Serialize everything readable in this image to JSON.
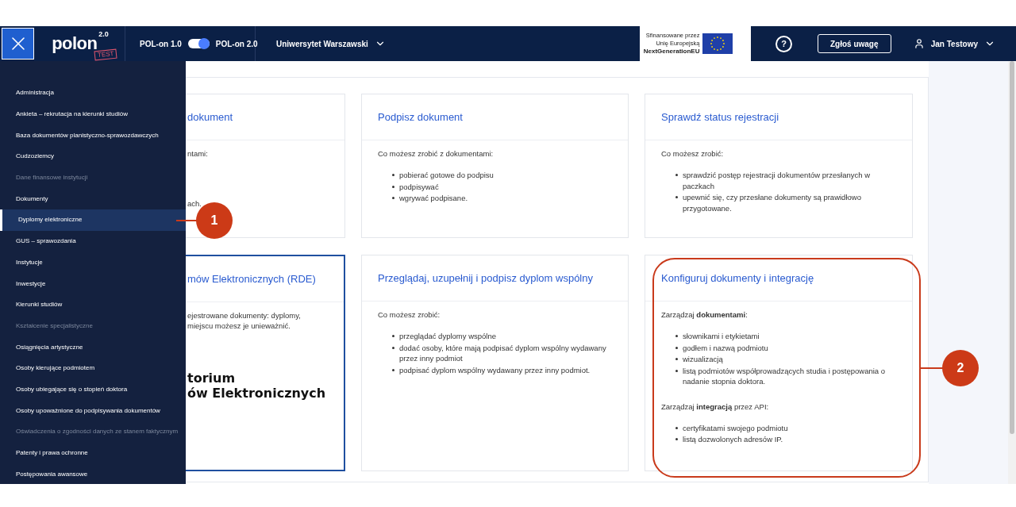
{
  "header": {
    "logo": {
      "name": "polon",
      "version": "2.0",
      "stamp": "TEST"
    },
    "version_switch": {
      "left": "POL-on 1.0",
      "right": "POL-on 2.0",
      "on": true
    },
    "institution": "Uniwersytet Warszawski",
    "eu_badge": {
      "lines": [
        "Sfinansowane przez",
        "Unię Europejską",
        "NextGenerationEU"
      ]
    },
    "help": "?",
    "feedback_button": "Zgłoś uwagę",
    "user": "Jan Testowy"
  },
  "sidebar": {
    "items": [
      {
        "label": "Administracja",
        "selected": false,
        "disabled": false
      },
      {
        "label": "Ankieta – rekrutacja na kierunki studiów",
        "selected": false,
        "disabled": false
      },
      {
        "label": "Baza dokumentów planistyczno-sprawozdawczych",
        "selected": false,
        "disabled": false
      },
      {
        "label": "Cudzoziemcy",
        "selected": false,
        "disabled": false
      },
      {
        "label": "Dane finansowe instytucji",
        "selected": false,
        "disabled": true
      },
      {
        "label": "Dokumenty",
        "selected": false,
        "disabled": false
      },
      {
        "label": "Dyplomy elektroniczne",
        "selected": true,
        "disabled": false
      },
      {
        "label": "GUS – sprawozdania",
        "selected": false,
        "disabled": false
      },
      {
        "label": "Instytucje",
        "selected": false,
        "disabled": false
      },
      {
        "label": "Inwestycje",
        "selected": false,
        "disabled": false
      },
      {
        "label": "Kierunki studiów",
        "selected": false,
        "disabled": false
      },
      {
        "label": "Kształcenie specjalistyczne",
        "selected": false,
        "disabled": true
      },
      {
        "label": "Osiągnięcia artystyczne",
        "selected": false,
        "disabled": false
      },
      {
        "label": "Osoby kierujące podmiotem",
        "selected": false,
        "disabled": false
      },
      {
        "label": "Osoby ubiegające się o stopień doktora",
        "selected": false,
        "disabled": false
      },
      {
        "label": "Osoby upoważnione do podpisywania dokumentów",
        "selected": false,
        "disabled": false
      },
      {
        "label": "Oświadczenia o zgodności danych ze stanem faktycznym",
        "selected": false,
        "disabled": true
      },
      {
        "label": "Patenty i prawa ochronne",
        "selected": false,
        "disabled": false
      },
      {
        "label": "Postępowania awansowe",
        "selected": false,
        "disabled": false
      }
    ]
  },
  "cards": [
    {
      "kind": "partial",
      "highlighted": false,
      "title": "dokument",
      "body": [
        {
          "kind": "text",
          "text": "ntami:"
        },
        {
          "kind": "gap"
        },
        {
          "kind": "text",
          "text": "ach."
        }
      ]
    },
    {
      "kind": "full",
      "highlighted": false,
      "title": "Podpisz dokument",
      "body": [
        {
          "kind": "text",
          "text": "Co możesz zrobić z dokumentami:"
        },
        {
          "kind": "list",
          "items": [
            "pobierać gotowe do podpisu",
            "podpisywać",
            "wgrywać podpisane."
          ]
        }
      ]
    },
    {
      "kind": "full",
      "highlighted": false,
      "title": "Sprawdź status rejestracji",
      "body": [
        {
          "kind": "text",
          "text": "Co możesz zrobić:"
        },
        {
          "kind": "list",
          "items": [
            "sprawdzić postęp rejestracji dokumentów przesłanych w paczkach",
            "upewnić się, czy przesłane dokumenty są prawidłowo przygotowane."
          ]
        }
      ]
    },
    {
      "kind": "partial",
      "highlighted": true,
      "title": "mów Elektronicznych (RDE)",
      "body": [
        {
          "kind": "text",
          "text": "ejestrowane dokumenty: dyplomy,"
        },
        {
          "kind": "text",
          "text": "miejscu możesz je unieważnić."
        },
        {
          "kind": "logo",
          "lines": [
            "torium",
            "ów Elektronicznych"
          ]
        }
      ]
    },
    {
      "kind": "full",
      "highlighted": false,
      "title": "Przeglądaj, uzupełnij i podpisz dyplom wspólny",
      "body": [
        {
          "kind": "text",
          "text": "Co możesz zrobić:"
        },
        {
          "kind": "list",
          "items": [
            "przeglądać dyplomy wspólne",
            "dodać osoby, które mają podpisać dyplom wspólny wydawany przez inny podmiot",
            "podpisać dyplom wspólny wydawany przez inny podmiot."
          ]
        }
      ]
    },
    {
      "kind": "full",
      "highlighted": false,
      "title": "Konfiguruj dokumenty i integrację",
      "body": [
        {
          "kind": "text",
          "text": "Zarządzaj **dokumentami**:"
        },
        {
          "kind": "list",
          "items": [
            "słownikami i etykietami",
            "godłem i nazwą podmiotu",
            "wizualizacją",
            "listą podmiotów współprowadzących studia i postępowania o nadanie stopnia doktora."
          ]
        },
        {
          "kind": "text",
          "text": "Zarządzaj **integracją** przez API:"
        },
        {
          "kind": "list",
          "items": [
            "certyfikatami swojego podmiotu",
            "listą dozwolonych adresów IP."
          ]
        }
      ]
    }
  ],
  "callouts": [
    {
      "label": "1"
    },
    {
      "label": "2"
    }
  ]
}
